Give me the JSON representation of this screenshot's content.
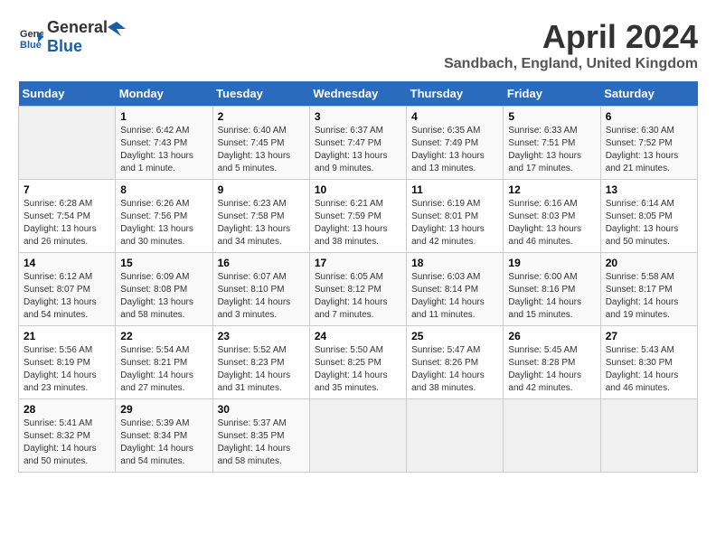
{
  "header": {
    "logo_general": "General",
    "logo_blue": "Blue",
    "title": "April 2024",
    "subtitle": "Sandbach, England, United Kingdom"
  },
  "days_of_week": [
    "Sunday",
    "Monday",
    "Tuesday",
    "Wednesday",
    "Thursday",
    "Friday",
    "Saturday"
  ],
  "weeks": [
    [
      {
        "day": "",
        "empty": true
      },
      {
        "day": "1",
        "sunrise": "Sunrise: 6:42 AM",
        "sunset": "Sunset: 7:43 PM",
        "daylight": "Daylight: 13 hours and 1 minute."
      },
      {
        "day": "2",
        "sunrise": "Sunrise: 6:40 AM",
        "sunset": "Sunset: 7:45 PM",
        "daylight": "Daylight: 13 hours and 5 minutes."
      },
      {
        "day": "3",
        "sunrise": "Sunrise: 6:37 AM",
        "sunset": "Sunset: 7:47 PM",
        "daylight": "Daylight: 13 hours and 9 minutes."
      },
      {
        "day": "4",
        "sunrise": "Sunrise: 6:35 AM",
        "sunset": "Sunset: 7:49 PM",
        "daylight": "Daylight: 13 hours and 13 minutes."
      },
      {
        "day": "5",
        "sunrise": "Sunrise: 6:33 AM",
        "sunset": "Sunset: 7:51 PM",
        "daylight": "Daylight: 13 hours and 17 minutes."
      },
      {
        "day": "6",
        "sunrise": "Sunrise: 6:30 AM",
        "sunset": "Sunset: 7:52 PM",
        "daylight": "Daylight: 13 hours and 21 minutes."
      }
    ],
    [
      {
        "day": "7",
        "sunrise": "Sunrise: 6:28 AM",
        "sunset": "Sunset: 7:54 PM",
        "daylight": "Daylight: 13 hours and 26 minutes."
      },
      {
        "day": "8",
        "sunrise": "Sunrise: 6:26 AM",
        "sunset": "Sunset: 7:56 PM",
        "daylight": "Daylight: 13 hours and 30 minutes."
      },
      {
        "day": "9",
        "sunrise": "Sunrise: 6:23 AM",
        "sunset": "Sunset: 7:58 PM",
        "daylight": "Daylight: 13 hours and 34 minutes."
      },
      {
        "day": "10",
        "sunrise": "Sunrise: 6:21 AM",
        "sunset": "Sunset: 7:59 PM",
        "daylight": "Daylight: 13 hours and 38 minutes."
      },
      {
        "day": "11",
        "sunrise": "Sunrise: 6:19 AM",
        "sunset": "Sunset: 8:01 PM",
        "daylight": "Daylight: 13 hours and 42 minutes."
      },
      {
        "day": "12",
        "sunrise": "Sunrise: 6:16 AM",
        "sunset": "Sunset: 8:03 PM",
        "daylight": "Daylight: 13 hours and 46 minutes."
      },
      {
        "day": "13",
        "sunrise": "Sunrise: 6:14 AM",
        "sunset": "Sunset: 8:05 PM",
        "daylight": "Daylight: 13 hours and 50 minutes."
      }
    ],
    [
      {
        "day": "14",
        "sunrise": "Sunrise: 6:12 AM",
        "sunset": "Sunset: 8:07 PM",
        "daylight": "Daylight: 13 hours and 54 minutes."
      },
      {
        "day": "15",
        "sunrise": "Sunrise: 6:09 AM",
        "sunset": "Sunset: 8:08 PM",
        "daylight": "Daylight: 13 hours and 58 minutes."
      },
      {
        "day": "16",
        "sunrise": "Sunrise: 6:07 AM",
        "sunset": "Sunset: 8:10 PM",
        "daylight": "Daylight: 14 hours and 3 minutes."
      },
      {
        "day": "17",
        "sunrise": "Sunrise: 6:05 AM",
        "sunset": "Sunset: 8:12 PM",
        "daylight": "Daylight: 14 hours and 7 minutes."
      },
      {
        "day": "18",
        "sunrise": "Sunrise: 6:03 AM",
        "sunset": "Sunset: 8:14 PM",
        "daylight": "Daylight: 14 hours and 11 minutes."
      },
      {
        "day": "19",
        "sunrise": "Sunrise: 6:00 AM",
        "sunset": "Sunset: 8:16 PM",
        "daylight": "Daylight: 14 hours and 15 minutes."
      },
      {
        "day": "20",
        "sunrise": "Sunrise: 5:58 AM",
        "sunset": "Sunset: 8:17 PM",
        "daylight": "Daylight: 14 hours and 19 minutes."
      }
    ],
    [
      {
        "day": "21",
        "sunrise": "Sunrise: 5:56 AM",
        "sunset": "Sunset: 8:19 PM",
        "daylight": "Daylight: 14 hours and 23 minutes."
      },
      {
        "day": "22",
        "sunrise": "Sunrise: 5:54 AM",
        "sunset": "Sunset: 8:21 PM",
        "daylight": "Daylight: 14 hours and 27 minutes."
      },
      {
        "day": "23",
        "sunrise": "Sunrise: 5:52 AM",
        "sunset": "Sunset: 8:23 PM",
        "daylight": "Daylight: 14 hours and 31 minutes."
      },
      {
        "day": "24",
        "sunrise": "Sunrise: 5:50 AM",
        "sunset": "Sunset: 8:25 PM",
        "daylight": "Daylight: 14 hours and 35 minutes."
      },
      {
        "day": "25",
        "sunrise": "Sunrise: 5:47 AM",
        "sunset": "Sunset: 8:26 PM",
        "daylight": "Daylight: 14 hours and 38 minutes."
      },
      {
        "day": "26",
        "sunrise": "Sunrise: 5:45 AM",
        "sunset": "Sunset: 8:28 PM",
        "daylight": "Daylight: 14 hours and 42 minutes."
      },
      {
        "day": "27",
        "sunrise": "Sunrise: 5:43 AM",
        "sunset": "Sunset: 8:30 PM",
        "daylight": "Daylight: 14 hours and 46 minutes."
      }
    ],
    [
      {
        "day": "28",
        "sunrise": "Sunrise: 5:41 AM",
        "sunset": "Sunset: 8:32 PM",
        "daylight": "Daylight: 14 hours and 50 minutes."
      },
      {
        "day": "29",
        "sunrise": "Sunrise: 5:39 AM",
        "sunset": "Sunset: 8:34 PM",
        "daylight": "Daylight: 14 hours and 54 minutes."
      },
      {
        "day": "30",
        "sunrise": "Sunrise: 5:37 AM",
        "sunset": "Sunset: 8:35 PM",
        "daylight": "Daylight: 14 hours and 58 minutes."
      },
      {
        "day": "",
        "empty": true
      },
      {
        "day": "",
        "empty": true
      },
      {
        "day": "",
        "empty": true
      },
      {
        "day": "",
        "empty": true
      }
    ]
  ]
}
